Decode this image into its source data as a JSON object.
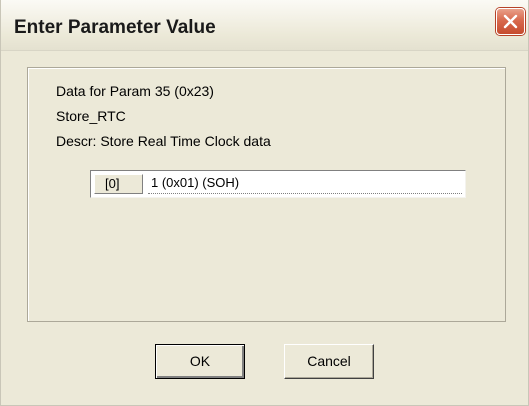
{
  "window": {
    "title": "Enter Parameter Value"
  },
  "info": {
    "line1": "Data for Param 35 (0x23)",
    "line2": "Store_RTC",
    "line3": "Descr: Store Real Time Clock data"
  },
  "param_rows": [
    {
      "index": "[0]",
      "value": "1 (0x01) (SOH)"
    }
  ],
  "buttons": {
    "ok_label": "OK",
    "cancel_label": "Cancel"
  },
  "colors": {
    "dialog_bg": "#ece9d8",
    "close_button": "#d86a4e"
  }
}
